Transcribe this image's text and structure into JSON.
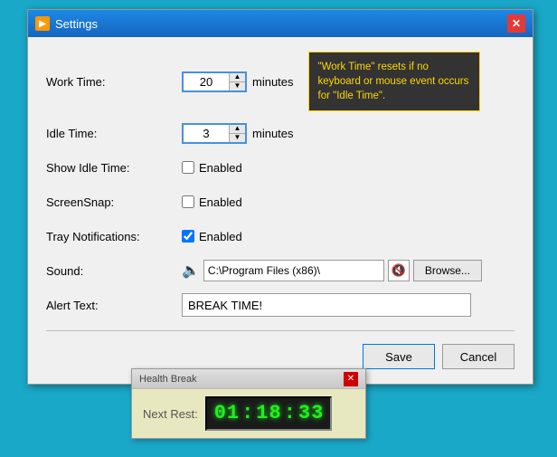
{
  "window": {
    "title": "Settings",
    "close_label": "✕"
  },
  "form": {
    "work_time_label": "Work Time:",
    "work_time_value": "20",
    "work_time_unit": "minutes",
    "idle_time_label": "Idle Time:",
    "idle_time_value": "3",
    "idle_time_unit": "minutes",
    "show_idle_label": "Show Idle Time:",
    "show_idle_checked": false,
    "show_idle_text": "Enabled",
    "screensnap_label": "ScreenSnap:",
    "screensnap_checked": false,
    "screensnap_text": "Enabled",
    "tray_label": "Tray Notifications:",
    "tray_checked": true,
    "tray_text": "Enabled",
    "sound_label": "Sound:",
    "sound_path": "C:\\Program Files (x86)\\",
    "alert_label": "Alert Text:",
    "alert_value": "BREAK TIME!"
  },
  "tooltip": {
    "text": "\"Work Time\" resets if no keyboard or mouse event occurs for \"Idle Time\"."
  },
  "buttons": {
    "save": "Save",
    "cancel": "Cancel",
    "browse": "Browse..."
  },
  "health_break": {
    "title": "Health Break",
    "next_rest_label": "Next Rest:",
    "close_label": "✕",
    "time": {
      "d1": "0",
      "d2": "1",
      "d3": "1",
      "d4": "8",
      "d5": "3",
      "d6": "3"
    }
  }
}
